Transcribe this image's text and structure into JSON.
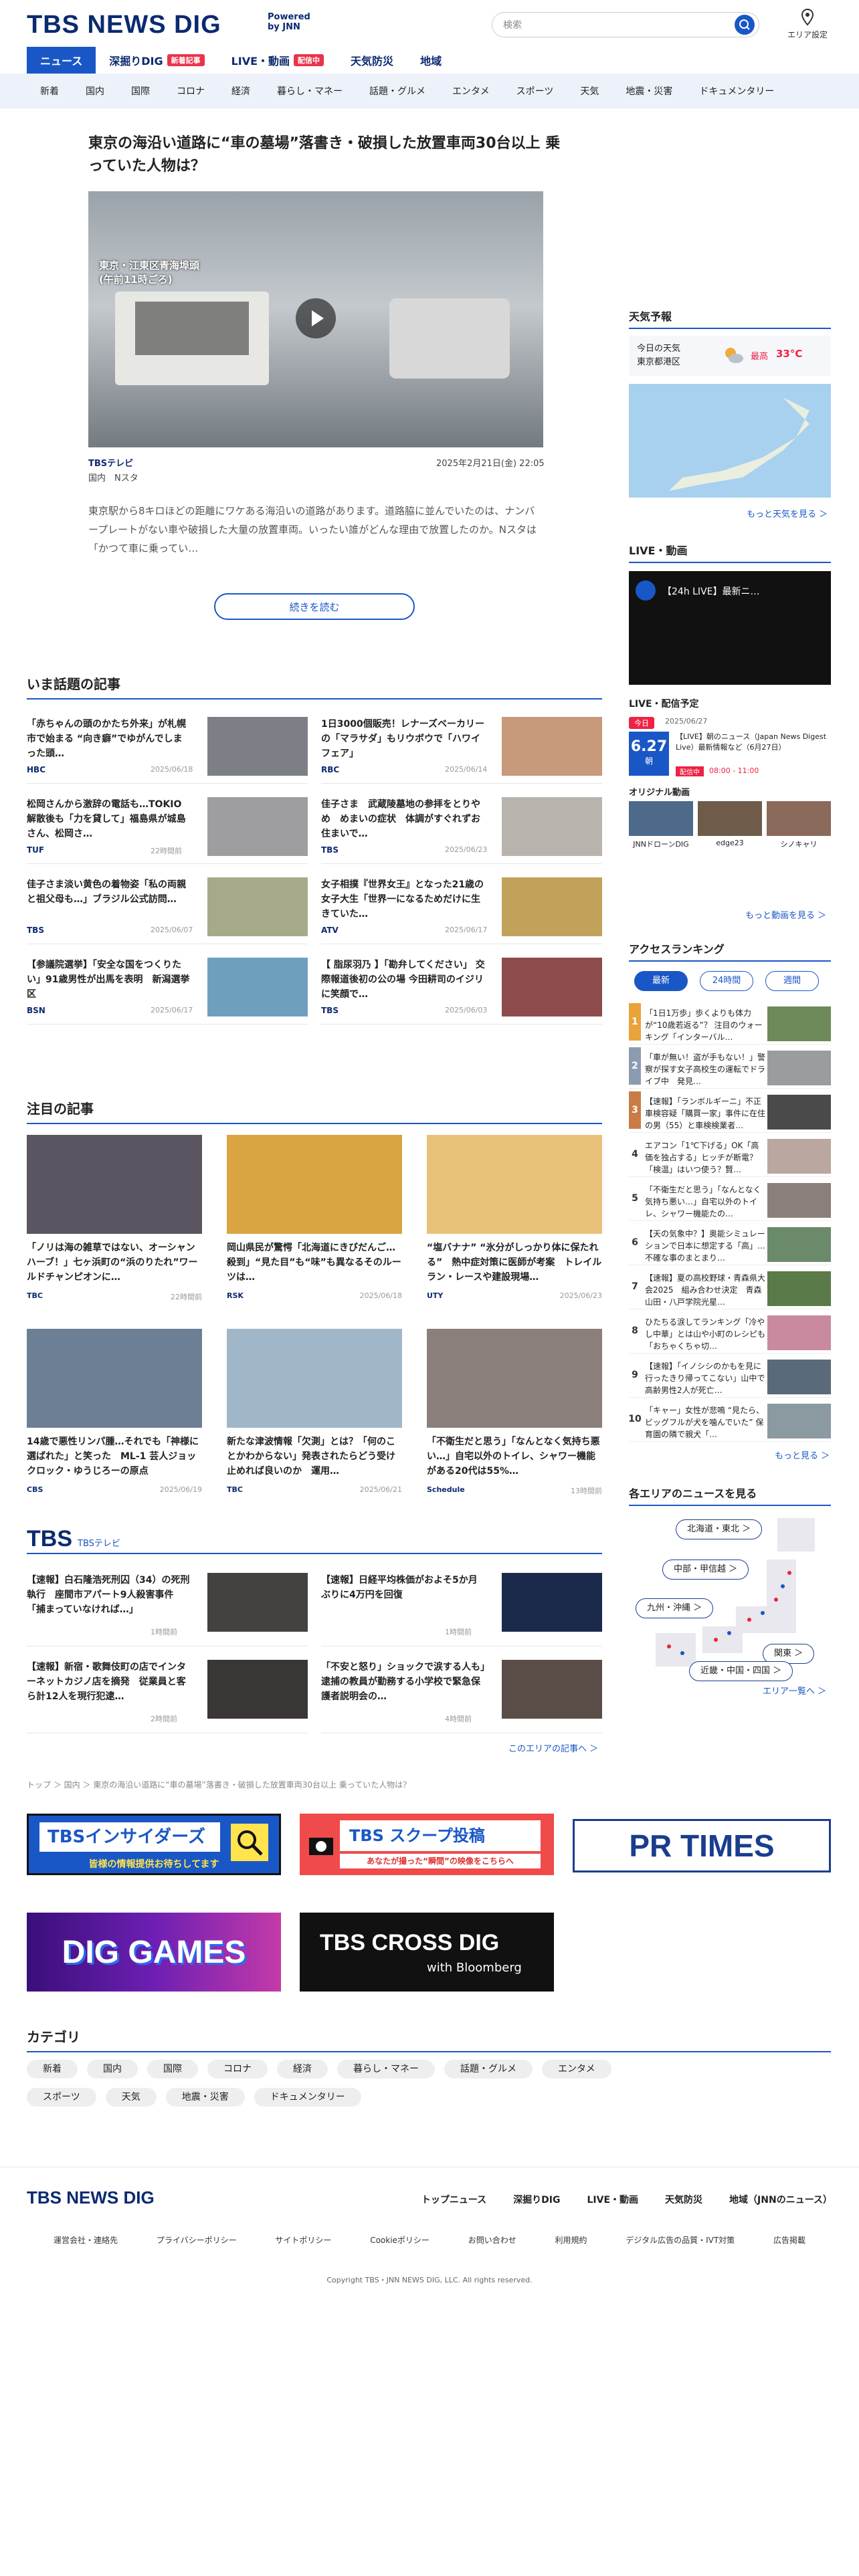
{
  "header": {
    "logo": "TBS NEWS DIG",
    "powered": "Powered\nby JNN",
    "search_placeholder": "検索",
    "area_setting": "エリア設定"
  },
  "tabs": [
    {
      "label": "ニュース"
    },
    {
      "label": "深掘りDIG",
      "badge": "新着記事"
    },
    {
      "label": "LIVE・動画",
      "badge": "配信中"
    },
    {
      "label": "天気防災"
    },
    {
      "label": "地域"
    }
  ],
  "categories_bar": [
    "新着",
    "国内",
    "国際",
    "コロナ",
    "経済",
    "暮らし・マネー",
    "話題・グルメ",
    "エンタメ",
    "スポーツ",
    "天気",
    "地震・災害",
    "ドキュメンタリー"
  ],
  "hero": {
    "title": "東京の海沿い道路に“車の墓場”落書き・破損した放置車両30台以上 乗っていた人物は？",
    "caption": "東京・江東区青海埠頭\n(午前11時ごろ)",
    "source": "TBSテレビ",
    "tags": "国内　Nスタ",
    "date": "2025年2月21日(金) 22:05",
    "summary": "東京駅から8キロほどの距離にワケある海沿いの道路があります。道路脇に並んでいたのは、ナンバープレートがない車や破損した大量の放置車両。いったい誰がどんな理由で放置したのか。Nスタは「かつて車に乗ってい…",
    "more": "続きを読む"
  },
  "trending": {
    "title": "いま話題の記事",
    "items": [
      {
        "title": "「赤ちゃんの頭のかたち外来」が札幌市で始まる “向き癖”でゆがんでしまった頭…",
        "src": "HBC",
        "time": "2025/06/18"
      },
      {
        "title": "1日3000個販売！レナーズベーカリーの「マラサダ」もリウボウで「ハワイフェア」",
        "src": "RBC",
        "time": "2025/06/14"
      },
      {
        "title": "松岡さんから激辞の電話も…TOKIO解散後も「力を貸して」福島県が城島さん、松岡さ…",
        "src": "TUF",
        "time": "22時間前"
      },
      {
        "title": "佳子さま　武蔵陵墓地の参拝をとりやめ　めまいの症状　体調がすぐれずお住まいで…",
        "src": "TBS",
        "time": "2025/06/23"
      },
      {
        "title": "佳子さま淡い黄色の着物姿「私の両親と祖父母も…」ブラジル公式訪問…",
        "src": "TBS",
        "time": "2025/06/07"
      },
      {
        "title": "女子相撲『世界女王』となった21歳の女子大生「世界一になるためだけに生きていた…",
        "src": "ATV",
        "time": "2025/06/17"
      },
      {
        "title": "【参議院選挙】「安全な国をつくりたい」91歳男性が出馬を表明　新潟選挙区",
        "src": "BSN",
        "time": "2025/06/17"
      },
      {
        "title": "【 脂尿羽乃 】「勘弁してください」 交際報道後初の公の場 今田耕司のイジリに笑顔で…",
        "src": "TBS",
        "time": "2025/06/03"
      }
    ]
  },
  "featured": {
    "title": "注目の記事",
    "items": [
      {
        "title": "「ノリは海の雑草ではない、オーシャンハーブ！」七ヶ浜町の“浜のりたれ”ワールドチャンピオンに…",
        "src": "TBC",
        "time": "22時間前"
      },
      {
        "title": "岡山県民が驚愕「北海道にきびだんご…殺到」“見た目”も“味”も異なるそのルーツは…",
        "src": "RSK",
        "time": "2025/06/18"
      },
      {
        "title": "“塩バナナ” “氷分がしっかり体に保たれる”　熱中症対策に医師が考案　トレイルラン・レースや建設現場…",
        "src": "UTY",
        "time": "2025/06/23"
      },
      {
        "title": "14歳で悪性リンパ腫…それでも「神様に選ばれた」と笑った　ML-1 芸人ジョックロック・ゆうじろーの原点",
        "src": "CBS",
        "time": "2025/06/19"
      },
      {
        "title": "新たな津波情報「欠測」とは？「何のことかわからない」発表されたらどう受け止めれば良いのか　運用…",
        "src": "TBC",
        "time": "2025/06/21"
      },
      {
        "title": "「不衛生だと思う」「なんとなく気持ち悪い…」自宅以外のトイレ、シャワー機能がある20代は55%…",
        "src": "Schedule",
        "time": "13時間前"
      }
    ]
  },
  "tbs": {
    "title": "TBS",
    "subtitle": "TBSテレビ",
    "items": [
      {
        "title": "【速報】白石隆浩死刑囚（34）の死刑執行　座間市アパート9人殺害事件「捕まっていなければ…」",
        "time": "1時間前"
      },
      {
        "title": "【速報】日経平均株価がおよそ5か月ぶりに4万円を回復",
        "time": "1時間前"
      },
      {
        "title": "【速報】新宿・歌舞伎町の店でインターネットカジノ店を摘発　従業員と客ら計12人を現行犯逮…",
        "time": "2時間前"
      },
      {
        "title": "「不安と怒り」ショックで涙する人も」逮捕の教員が勤務する小学校で緊急保護者説明会の…",
        "time": "4時間前"
      }
    ],
    "more": "このエリアの記事へ ＞"
  },
  "breadcrumb": "トップ ＞ 国内 ＞ 東京の海沿い道路に“車の墓場”落書き・破損した放置車両30台以上 乗っていた人物は？",
  "banners": {
    "insiders": "TBSインサイダーズ",
    "insiders_sub": "皆様の情報提供お待ちしてます",
    "scoop": "TBS スクープ投稿",
    "scoop_sub": "あなたが撮った“瞬間”の映像をこちらへ",
    "prtimes": "PR TIMES",
    "diggames": "DIG GAMES",
    "crossdig": "TBS CROSS DIG",
    "crossdig_sub": "with Bloomberg"
  },
  "category": {
    "title": "カテゴリ",
    "items": [
      "新着",
      "国内",
      "国際",
      "コロナ",
      "経済",
      "暮らし・マネー",
      "話題・グルメ",
      "エンタメ",
      "スポーツ",
      "天気",
      "地震・災害",
      "ドキュメンタリー"
    ]
  },
  "footer": {
    "logo": "TBS NEWS DIG",
    "nav": [
      "トップニュース",
      "深掘りDIG",
      "LIVE・動画",
      "天気防災",
      "地域（JNNのニュース）"
    ],
    "links": [
      "運営会社・連絡先",
      "プライバシーポリシー",
      "サイトポリシー",
      "Cookieポリシー",
      "お問い合わせ",
      "利用規約",
      "デジタル広告の品質・IVT対策",
      "広告掲載"
    ],
    "copyright": "Copyright TBS・JNN NEWS DIG, LLC. All rights reserved."
  },
  "side": {
    "weather": {
      "title": "天気予報",
      "today": "今日の天気\n東京都港区",
      "high_label": "最高",
      "high": "33°C",
      "more": "もっと天気を見る ＞"
    },
    "live": {
      "title": "LIVE・動画",
      "player_title": "【24h LIVE】最新ニ…",
      "schedule_title": "LIVE・配信予定",
      "date_badge": "今日",
      "date": "2025/06/27",
      "big_date": "6.27",
      "big_sub": "朝",
      "program": "【LIVE】朝のニュース（Japan News Digest Live）最新情報など（6月27日）",
      "time_badge": "配信中",
      "time": "08:00 - 11:00",
      "original": "オリジナル動画",
      "orig_items": [
        "JNNドローンDIG",
        "edge23",
        "シノキャリ"
      ],
      "more": "もっと動画を見る ＞"
    },
    "ranking": {
      "title": "アクセスランキング",
      "tabs": [
        "最新",
        "24時間",
        "週間"
      ],
      "items": [
        "「1日1万歩」歩くよりも体力が“10歳若返る”？ 注目のウォーキング「インターバル…",
        "「車が無い！盗が手もない！」警察が探す女子高校生の運転でドライブ中　発見…",
        "【速報】「ランボルギーニ」不正車検容疑「購買一家」事件に在住の男（55）と車検検業者…",
        "エアコン「1℃下げる」OK「高価を独占する」ヒッチが断電？「検温」はいつ使う？賢…",
        "「不衛生だと思う」「なんとなく気持ち悪い…」自宅以外のトイレ、シャワー機能たの…",
        "【天の気象中？】奥能シミュレーションで日本に想定する「高」…不確な事のまとまり…",
        "【速報】夏の高校野球・青森県大会2025　組み合わせ決定　青森山田・八戸学院光星…",
        "ひたちる涙してランキング「冷やし中華」とは山や小町のレシピも「おちゃくちゃ切…",
        "【速報】「イノシシのかもを見に行ったきり帰ってこない」山中で高齢男性2人が死亡…",
        "「キャー」女性が悲鳴 “見たら、ビッグフルが犬を噛んでいた” 保育園の隣で親犬「…"
      ],
      "more": "もっと見る ＞"
    },
    "areas": {
      "title": "各エリアのニュースを見る",
      "items": [
        "北海道・東北 ＞",
        "中部・甲信越 ＞",
        "九州・沖縄 ＞",
        "関東 ＞",
        "近畿・中国・四国 ＞"
      ],
      "more": "エリア一覧へ ＞"
    }
  }
}
